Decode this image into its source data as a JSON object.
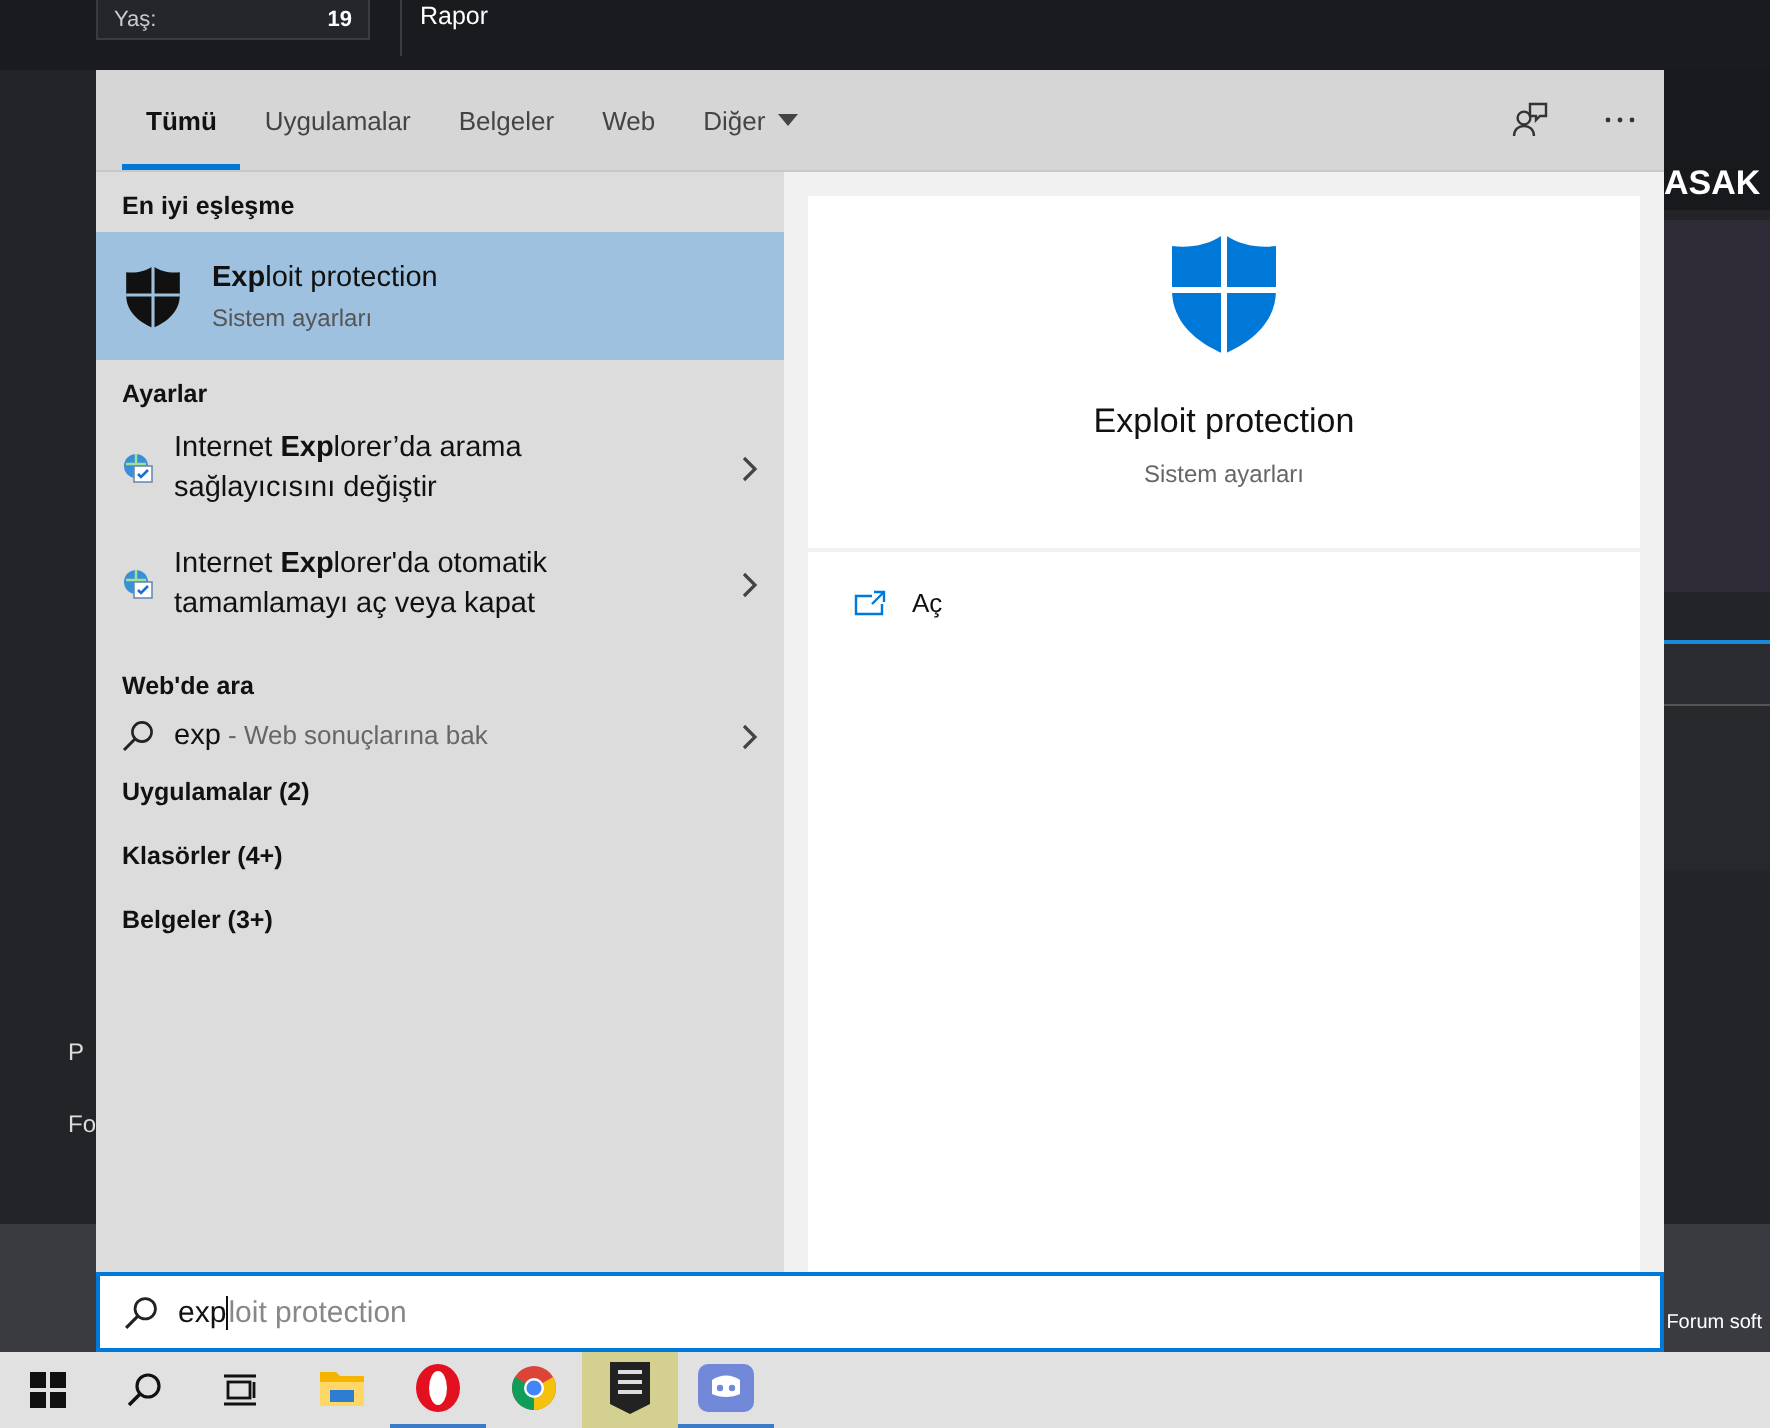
{
  "background_page": {
    "profile_label": "Yaş:",
    "profile_value": "19",
    "report_link": "Rapor",
    "heading_fragment": "ASAK",
    "left_fragments": [
      "P",
      "Fo"
    ],
    "footer_fragment": "Forum soft"
  },
  "search_panel": {
    "tabs": [
      {
        "label": "Tümü",
        "selected": true,
        "kind": "tab"
      },
      {
        "label": "Uygulamalar",
        "selected": false,
        "kind": "tab"
      },
      {
        "label": "Belgeler",
        "selected": false,
        "kind": "tab"
      },
      {
        "label": "Web",
        "selected": false,
        "kind": "tab"
      },
      {
        "label": "Diğer",
        "selected": false,
        "kind": "dropdown"
      }
    ],
    "best_match": {
      "heading": "En iyi eşleşme",
      "title": "**Exp**loit protection",
      "subtitle": "Sistem ayarları",
      "selected": true
    },
    "sections": [
      {
        "heading": "Ayarlar",
        "items": [
          {
            "kind": "setting",
            "text": "Internet **Exp**lorer’da arama\nsağlayıcısını değiştir"
          },
          {
            "kind": "setting",
            "text": "Internet **Exp**lorer'da otomatik\ntamamlamayı aç veya kapat"
          }
        ]
      },
      {
        "heading": "Web'de ara",
        "items": [
          {
            "kind": "web",
            "query": "exp",
            "hint": "- Web sonuçlarına bak"
          }
        ]
      }
    ],
    "categories": [
      "Uygulamalar (2)",
      "Klasörler (4+)",
      "Belgeler (3+)"
    ],
    "preview": {
      "title": "Exploit protection",
      "subtitle": "Sistem ayarları",
      "actions": [
        {
          "label": "Aç"
        }
      ]
    },
    "search_box": {
      "value": "exp",
      "suggestion": "loit protection"
    }
  },
  "taskbar": {
    "apps": [
      {
        "kind": "explorer",
        "running": false,
        "highlighted": false
      },
      {
        "kind": "opera",
        "running": true,
        "highlighted": false
      },
      {
        "kind": "chrome",
        "running": false,
        "highlighted": false
      },
      {
        "kind": "epic",
        "running": false,
        "highlighted": true
      },
      {
        "kind": "discord",
        "running": true,
        "highlighted": false
      }
    ]
  }
}
